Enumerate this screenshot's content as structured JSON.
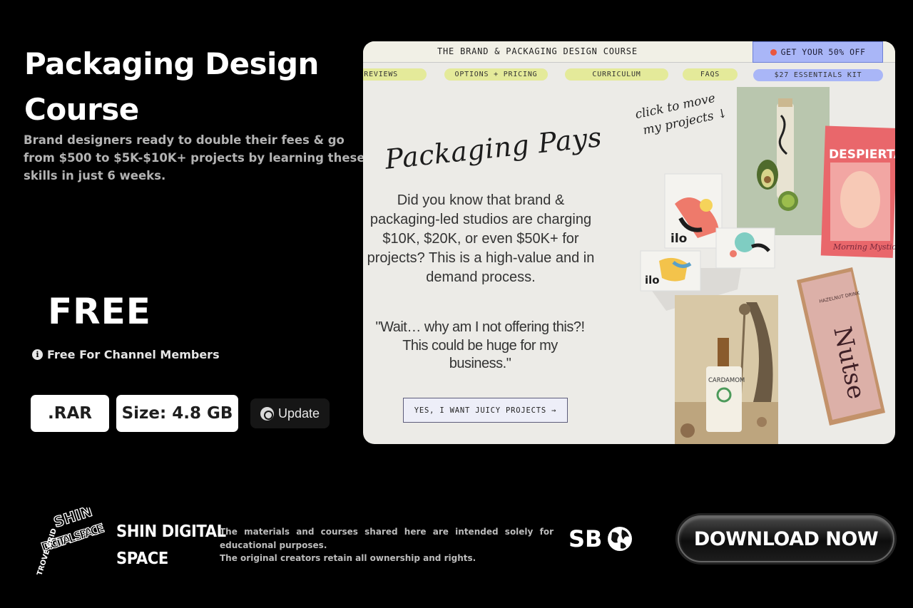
{
  "course": {
    "title": "Packaging Design Course",
    "subtitle": "Brand designers ready to double their fees & go from $500 to $5K-$10K+ projects by learning these skills in just 6 weeks.",
    "price": "FREE",
    "member_note": "Free For Channel Members",
    "format": ".RAR",
    "size": "Size: 4.8 GB",
    "update_label": "Update"
  },
  "preview": {
    "topbar_title": "THE BRAND & PACKAGING DESIGN COURSE",
    "offer_label": "GET YOUR 50% OFF",
    "nav": [
      "REVIEWS",
      "OPTIONS + PRICING",
      "CURRICULUM",
      "FAQS",
      "$27 ESSENTIALS KIT"
    ],
    "script_heading": "Packaging Pays",
    "body": "Did you know that brand & packaging-led studios are charging $10K, $20K, or even $50K+ for projects? This is a high-value and in demand process.",
    "quote": "\"Wait… why am I not offering this?! This could be huge for my business.\"",
    "cta": "YES, I WANT JUICY PROJECTS →",
    "handnote_line1": "click to move",
    "handnote_line2": "my projects ↓",
    "products": {
      "despierta": "DESPIERTA",
      "despierta_sub": "Morning Mystic",
      "ilo": "ilo",
      "cardamom": "CARDAMOM",
      "nutse": "Nutse",
      "nutse_top": "HAZELNUT DRINK"
    },
    "colors": {
      "nav_pill": "#e4ea9a",
      "accent": "#a9b6f7",
      "background": "#ecebe7"
    }
  },
  "footer": {
    "logo_text": "DIGITAL SPACE",
    "logo_small": "TROVE GRID",
    "logo_top": "SHIN",
    "brand_line1": "SHIN DIGITAL",
    "brand_line2": "SPACE",
    "disclaimer_line1": "The materials and courses shared here are intended solely for educational purposes.",
    "disclaimer_line2": "The original creators retain all ownership and rights.",
    "sb_label": "SB",
    "globe_icon": "globe-icon",
    "download_label": "DOWNLOAD NOW"
  }
}
